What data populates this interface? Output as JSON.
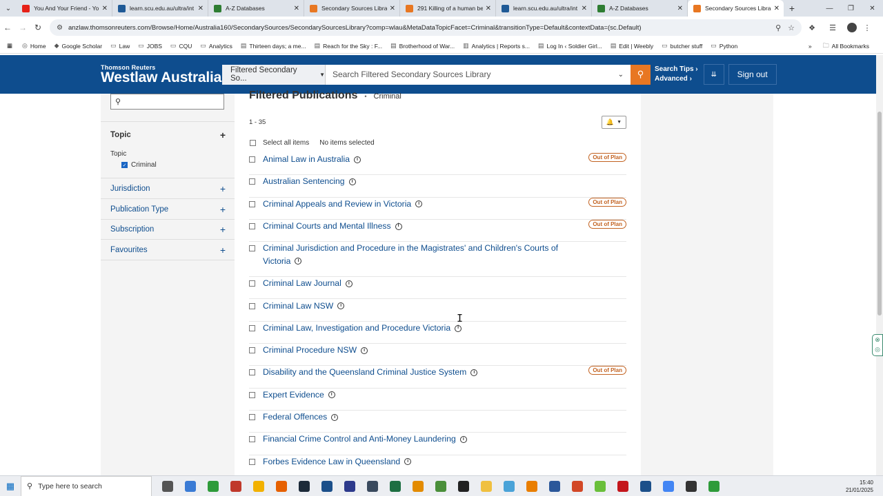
{
  "browser": {
    "tabs": [
      {
        "title": "You And Your Friend - Yo",
        "icon": "youtube-icon",
        "color": "#e62117",
        "active": false
      },
      {
        "title": "learn.scu.edu.au/ultra/int",
        "icon": "blackboard-icon",
        "color": "#1f5a96",
        "active": false
      },
      {
        "title": "A-Z Databases",
        "icon": "springshare-icon",
        "color": "#2e7d32",
        "active": false
      },
      {
        "title": "Secondary Sources Library",
        "icon": "westlaw-icon",
        "color": "#e87722",
        "active": false
      },
      {
        "title": "291 Killing of a human be",
        "icon": "westlaw-icon",
        "color": "#e87722",
        "active": false
      },
      {
        "title": "learn.scu.edu.au/ultra/int",
        "icon": "blackboard-icon",
        "color": "#1f5a96",
        "active": false
      },
      {
        "title": "A-Z Databases",
        "icon": "springshare-icon",
        "color": "#2e7d32",
        "active": false
      },
      {
        "title": "Secondary Sources Library",
        "icon": "westlaw-icon",
        "color": "#e87722",
        "active": true
      }
    ],
    "url": "anzlaw.thomsonreuters.com/Browse/Home/Australia160/SecondarySources/SecondarySourcesLibrary?comp=wlau&MetaDataTopicFacet=Criminal&transitionType=Default&contextData=(sc.Default)",
    "bookmarks": [
      {
        "label": "Home",
        "icon": "globe-icon"
      },
      {
        "label": "Google Scholar",
        "icon": "scholar-icon"
      },
      {
        "label": "Law",
        "icon": "folder-icon"
      },
      {
        "label": "JOBS",
        "icon": "folder-icon"
      },
      {
        "label": "CQU",
        "icon": "folder-icon"
      },
      {
        "label": "Analytics",
        "icon": "folder-icon"
      },
      {
        "label": "Thirteen days; a me...",
        "icon": "page-icon"
      },
      {
        "label": "Reach for the Sky : F...",
        "icon": "page-icon"
      },
      {
        "label": "Brotherhood of War...",
        "icon": "page-icon"
      },
      {
        "label": "Analytics | Reports s...",
        "icon": "analytics-icon"
      },
      {
        "label": "Log In ‹ Soldier Girl...",
        "icon": "page-icon"
      },
      {
        "label": "Edit | Weebly",
        "icon": "page-icon"
      },
      {
        "label": "butcher stuff",
        "icon": "folder-icon"
      },
      {
        "label": "Python",
        "icon": "folder-icon"
      }
    ],
    "all_bookmarks": "All Bookmarks"
  },
  "header": {
    "brand_small": "Thomson Reuters",
    "brand_main": "Westlaw Australia",
    "scope": "Filtered Secondary So...",
    "search_placeholder": "Search Filtered Secondary Sources Library",
    "search_tips": "Search Tips",
    "advanced": "Advanced",
    "sign_out": "Sign out"
  },
  "sidebar": {
    "topic_heading": "Topic",
    "topic_label": "Topic",
    "topic_selected": "Criminal",
    "facets": [
      "Jurisdiction",
      "Publication Type",
      "Subscription",
      "Favourites"
    ]
  },
  "main": {
    "title": "Filtered Publications",
    "filter": "Criminal",
    "range": "1 - 35",
    "select_all": "Select all items",
    "selected_status": "No items selected",
    "out_of_plan_label": "Out of Plan",
    "items": [
      {
        "title": "Animal Law in Australia",
        "out_of_plan": true
      },
      {
        "title": "Australian Sentencing",
        "out_of_plan": false
      },
      {
        "title": "Criminal Appeals and Review in Victoria",
        "out_of_plan": true
      },
      {
        "title": "Criminal Courts and Mental Illness",
        "out_of_plan": true
      },
      {
        "title": "Criminal Jurisdiction and Procedure in the Magistrates' and Children's Courts of Victoria",
        "out_of_plan": false
      },
      {
        "title": "Criminal Law Journal",
        "out_of_plan": false
      },
      {
        "title": "Criminal Law NSW",
        "out_of_plan": false
      },
      {
        "title": "Criminal Law, Investigation and Procedure Victoria",
        "out_of_plan": false
      },
      {
        "title": "Criminal Procedure NSW",
        "out_of_plan": false
      },
      {
        "title": "Disability and the Queensland Criminal Justice System",
        "out_of_plan": true
      },
      {
        "title": "Expert Evidence",
        "out_of_plan": false
      },
      {
        "title": "Federal Offences",
        "out_of_plan": false
      },
      {
        "title": "Financial Crime Control and Anti-Money Laundering",
        "out_of_plan": false
      },
      {
        "title": "Forbes Evidence Law in Queensland",
        "out_of_plan": false
      }
    ]
  },
  "taskbar": {
    "search_placeholder": "Type here to search",
    "time": "15:40",
    "date": "21/01/2025",
    "apps": [
      {
        "icon": "task-view-icon",
        "color": "#555555"
      },
      {
        "icon": "copilot-icon",
        "color": "#3a7bd5"
      },
      {
        "icon": "camtasia-icon",
        "color": "#2e9b3a"
      },
      {
        "icon": "filezilla-icon",
        "color": "#c0392b"
      },
      {
        "icon": "chrome-icon",
        "color": "#f2b100"
      },
      {
        "icon": "firefox-icon",
        "color": "#e66000"
      },
      {
        "icon": "kodi-icon",
        "color": "#1c2a39"
      },
      {
        "icon": "snagit-icon",
        "color": "#1b4f8a"
      },
      {
        "icon": "app-icon",
        "color": "#2d3a8c"
      },
      {
        "icon": "steam-icon",
        "color": "#3a4a5e"
      },
      {
        "icon": "excel-icon",
        "color": "#1d6f42"
      },
      {
        "icon": "app-icon",
        "color": "#e38b00"
      },
      {
        "icon": "notepad-icon",
        "color": "#4a8f3a"
      },
      {
        "icon": "editor-icon",
        "color": "#222222"
      },
      {
        "icon": "file-explorer-icon",
        "color": "#f0c040"
      },
      {
        "icon": "app-icon",
        "color": "#4aa3d8"
      },
      {
        "icon": "vlc-icon",
        "color": "#e97e00"
      },
      {
        "icon": "word-icon",
        "color": "#2b579a"
      },
      {
        "icon": "powerpoint-icon",
        "color": "#d24726"
      },
      {
        "icon": "app-icon",
        "color": "#6abf3b"
      },
      {
        "icon": "acrobat-icon",
        "color": "#c4161c"
      },
      {
        "icon": "snagit-editor-icon",
        "color": "#1b4f8a"
      },
      {
        "icon": "chrome-icon",
        "color": "#4285f4"
      },
      {
        "icon": "media-player-icon",
        "color": "#333333"
      },
      {
        "icon": "camtasia-icon",
        "color": "#2e9b3a"
      }
    ]
  }
}
